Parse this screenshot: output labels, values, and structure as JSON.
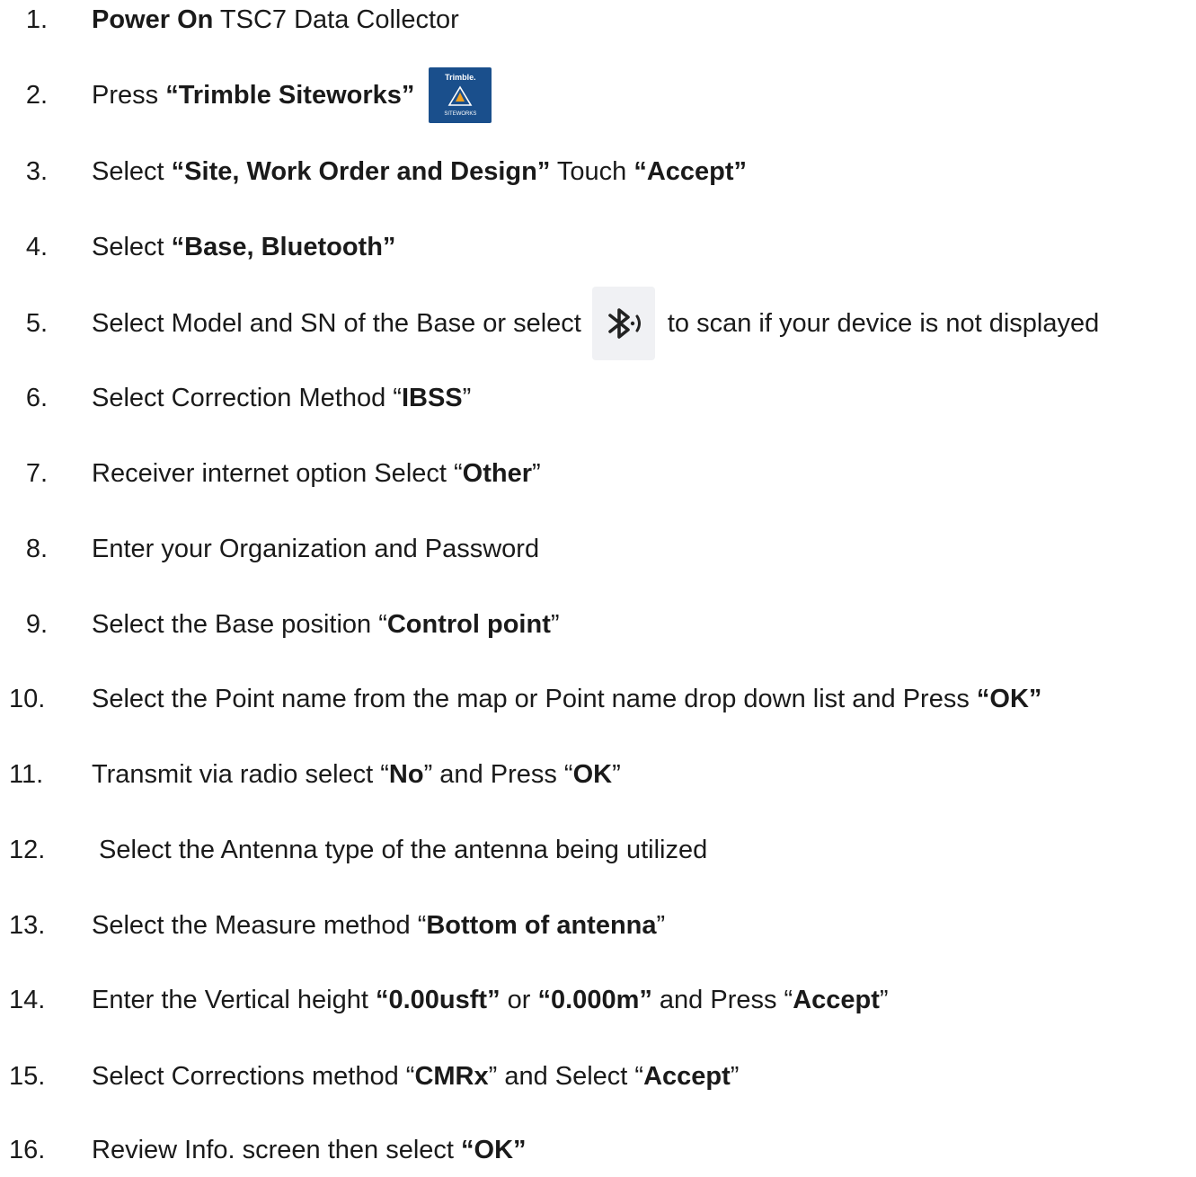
{
  "steps": [
    {
      "number": "1.",
      "parts": [
        {
          "t": "Power On",
          "b": true
        },
        {
          "t": " TSC7 Data Collector"
        }
      ]
    },
    {
      "number": "2.",
      "parts": [
        {
          "t": "Press "
        },
        {
          "t": "“Trimble Siteworks”",
          "b": true
        }
      ],
      "icon": {
        "name": "trimble-siteworks-icon",
        "brand": "Trimble.",
        "label": "SITEWORKS"
      }
    },
    {
      "number": "3.",
      "parts": [
        {
          "t": "Select "
        },
        {
          "t": "“Site, Work Order and Design”",
          "b": true
        },
        {
          "t": " Touch "
        },
        {
          "t": "“Accept”",
          "b": true
        }
      ]
    },
    {
      "number": "4.",
      "parts": [
        {
          "t": "Select "
        },
        {
          "t": "“Base, Bluetooth”",
          "b": true
        }
      ]
    },
    {
      "number": "5.",
      "parts": [
        {
          "t": "Select Model and SN of the Base or select"
        }
      ],
      "icon": {
        "name": "bluetooth-scan-icon"
      },
      "after": [
        {
          "t": "to scan if your device is not displayed"
        }
      ]
    },
    {
      "number": "6.",
      "parts": [
        {
          "t": "Select Correction Method “"
        },
        {
          "t": "IBSS",
          "b": true
        },
        {
          "t": "”"
        }
      ]
    },
    {
      "number": "7.",
      "parts": [
        {
          "t": "Receiver internet option Select “"
        },
        {
          "t": "Other",
          "b": true
        },
        {
          "t": "”"
        }
      ]
    },
    {
      "number": "8.",
      "parts": [
        {
          "t": "Enter your Organization and Password"
        }
      ]
    },
    {
      "number": "9.",
      "parts": [
        {
          "t": "Select the Base position “"
        },
        {
          "t": "Control point",
          "b": true
        },
        {
          "t": "”"
        }
      ]
    },
    {
      "number": "10.",
      "parts": [
        {
          "t": "Select the Point name from the map or Point name drop down list and Press "
        },
        {
          "t": "“OK”",
          "b": true
        }
      ]
    },
    {
      "number": "11.",
      "parts": [
        {
          "t": "Transmit via radio select “"
        },
        {
          "t": "No",
          "b": true
        },
        {
          "t": "” and Press “"
        },
        {
          "t": "OK",
          "b": true
        },
        {
          "t": "”"
        }
      ]
    },
    {
      "number": "12.",
      "parts": [
        {
          "t": " Select the Antenna type of the antenna being utilized"
        }
      ]
    },
    {
      "number": "13.",
      "parts": [
        {
          "t": "Select the Measure method “"
        },
        {
          "t": "Bottom of antenna",
          "b": true
        },
        {
          "t": "”"
        }
      ]
    },
    {
      "number": "14.",
      "parts": [
        {
          "t": "Enter the Vertical height "
        },
        {
          "t": "“0.00usft”",
          "b": true
        },
        {
          "t": " or "
        },
        {
          "t": "“0.000m”",
          "b": true
        },
        {
          "t": " and Press “"
        },
        {
          "t": "Accept",
          "b": true
        },
        {
          "t": "”"
        }
      ]
    },
    {
      "number": "15.",
      "parts": [
        {
          "t": "Select Corrections method “"
        },
        {
          "t": "CMRx",
          "b": true
        },
        {
          "t": "” and Select “"
        },
        {
          "t": "Accept",
          "b": true
        },
        {
          "t": "”"
        }
      ]
    },
    {
      "number": "16.",
      "parts": [
        {
          "t": "Review Info. screen then select "
        },
        {
          "t": "“OK”",
          "b": true
        }
      ]
    }
  ]
}
